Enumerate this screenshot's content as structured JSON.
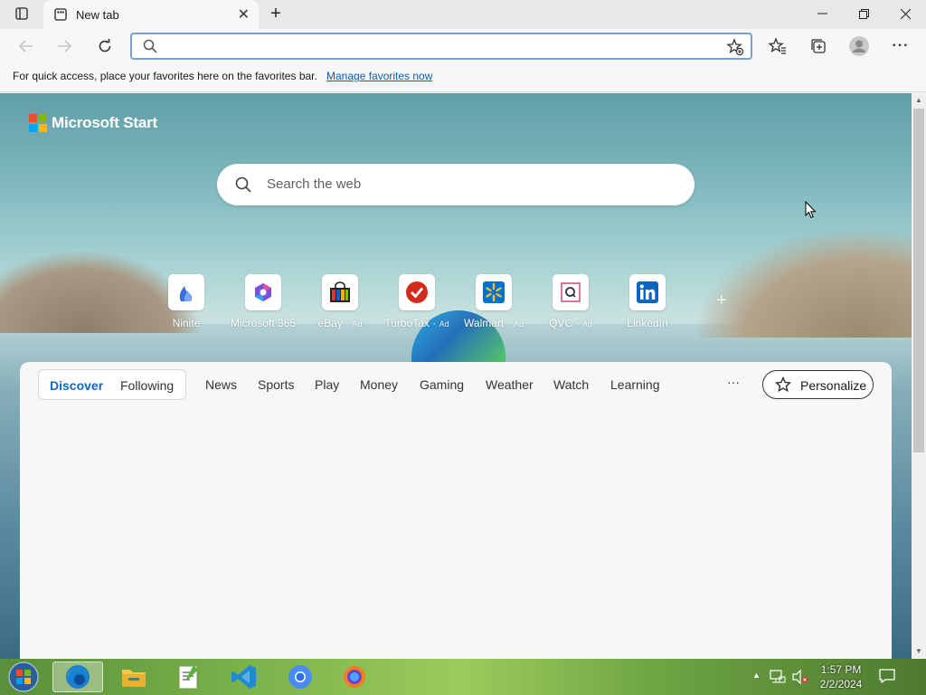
{
  "browser": {
    "tab_title": "New tab",
    "favorites_bar": {
      "message": "For quick access, place your favorites here on the favorites bar.",
      "link": "Manage favorites now"
    },
    "address_value": ""
  },
  "start_page": {
    "brand": "Microsoft Start",
    "search_placeholder": "Search the web",
    "tiles": [
      {
        "label": "Ninite",
        "ad": "",
        "icon": "ninite-icon"
      },
      {
        "label": "Microsoft 365",
        "ad": "",
        "icon": "microsoft-365-icon"
      },
      {
        "label": "eBay",
        "ad": "Ad",
        "icon": "ebay-icon"
      },
      {
        "label": "TurboTax",
        "ad": "Ad",
        "icon": "turbotax-icon"
      },
      {
        "label": "Walmart",
        "ad": "Ad",
        "icon": "walmart-icon"
      },
      {
        "label": "QVC",
        "ad": "Ad",
        "icon": "qvc-icon"
      },
      {
        "label": "LinkedIn",
        "ad": "",
        "icon": "linkedin-icon"
      }
    ],
    "feed": {
      "segment": [
        "Discover",
        "Following"
      ],
      "nav": [
        "News",
        "Sports",
        "Play",
        "Money",
        "Gaming",
        "Weather",
        "Watch",
        "Learning"
      ],
      "more": "···",
      "personalize": "Personalize"
    }
  },
  "taskbar": {
    "time": "1:57 PM",
    "date": "2/2/2024"
  },
  "colors": {
    "accent": "#0f6cbd",
    "link": "#0b5cad",
    "address_border": "#7da0c6"
  }
}
